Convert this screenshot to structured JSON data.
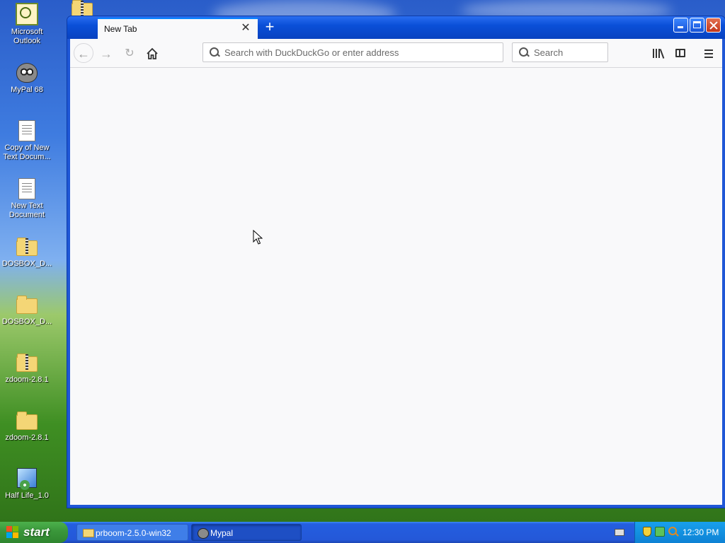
{
  "desktop": {
    "icons": [
      {
        "label": "Microsoft Outlook"
      },
      {
        "label": "MyPal 68"
      },
      {
        "label": "Copy of New Text Docum..."
      },
      {
        "label": "New Text Document"
      },
      {
        "label": "DOSBOX_D..."
      },
      {
        "label": "DOSBOX_D..."
      },
      {
        "label": "zdoom-2.8.1"
      },
      {
        "label": "zdoom-2.8.1"
      },
      {
        "label": "Half Life_1.0"
      }
    ]
  },
  "browser": {
    "tab": {
      "title": "New Tab"
    },
    "urlbar": {
      "placeholder": "Search with DuckDuckGo or enter address",
      "value": ""
    },
    "searchbar": {
      "placeholder": "Search",
      "value": ""
    }
  },
  "taskbar": {
    "start_label": "start",
    "tasks": [
      {
        "label": "prboom-2.5.0-win32"
      },
      {
        "label": "Mypal"
      }
    ],
    "clock": "12:30 PM"
  },
  "colors": {
    "accent": "#0a84ff",
    "titlebar": "#0a4fd8",
    "start_green": "#3a963a",
    "tray_blue": "#0e82d4"
  },
  "icons": {
    "back": "arrow-left-icon",
    "forward": "arrow-right-icon",
    "reload": "reload-icon",
    "home": "home-icon",
    "library": "library-icon",
    "sidebar": "sidebar-icon",
    "menu": "hamburger-icon"
  }
}
